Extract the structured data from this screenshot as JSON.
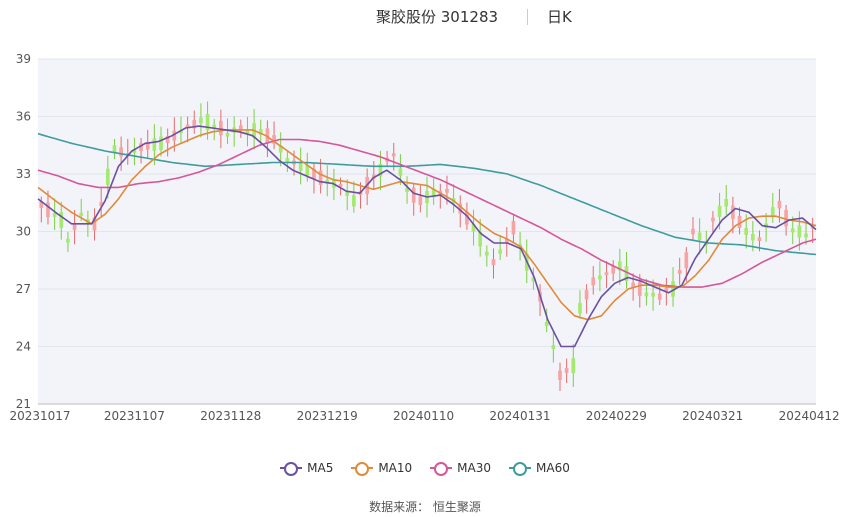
{
  "header": {
    "title": "聚胶股份 301283",
    "period": "日K"
  },
  "source": {
    "label": "数据来源：",
    "value": "恒生聚源"
  },
  "colors": {
    "up": "#f7a3a3",
    "down": "#a3ea6e",
    "ma5": "#6a4fa3",
    "ma10": "#e08a3a",
    "ma30": "#d6569a",
    "ma60": "#3f9c9c",
    "plot_bg": "#f3f4f9"
  },
  "chart_data": {
    "type": "candlestick",
    "ylim": [
      21,
      39
    ],
    "yticks": [
      "39",
      "36",
      "33",
      "30",
      "27",
      "24",
      "21"
    ],
    "ytick_values": [
      39,
      36,
      33,
      30,
      27,
      24,
      21
    ],
    "xtick_labels": [
      "20231017",
      "20231107",
      "20231128",
      "20231219",
      "20240110",
      "20240131",
      "20240229",
      "20240321",
      "20240412"
    ],
    "xtick_positions": [
      0,
      14,
      28,
      42,
      56,
      70,
      84,
      98,
      112
    ],
    "n_bars": 113,
    "legend": [
      "MA5",
      "MA10",
      "MA30",
      "MA60"
    ],
    "candle_keypoints": [
      [
        0,
        31.4
      ],
      [
        3,
        30.6
      ],
      [
        4,
        29.6
      ],
      [
        6,
        30.9
      ],
      [
        8,
        30.4
      ],
      [
        9,
        31.4
      ],
      [
        11,
        34.3
      ],
      [
        13,
        34.0
      ],
      [
        15,
        34.4
      ],
      [
        18,
        34.6
      ],
      [
        21,
        35.2
      ],
      [
        24,
        35.8
      ],
      [
        26,
        35.6
      ],
      [
        28,
        35.2
      ],
      [
        30,
        35.4
      ],
      [
        33,
        35.2
      ],
      [
        35,
        34.8
      ],
      [
        37,
        33.8
      ],
      [
        39,
        33.4
      ],
      [
        41,
        33.0
      ],
      [
        43,
        32.6
      ],
      [
        45,
        32.4
      ],
      [
        47,
        31.6
      ],
      [
        49,
        32.4
      ],
      [
        51,
        33.2
      ],
      [
        53,
        34.0
      ],
      [
        55,
        32.2
      ],
      [
        57,
        31.6
      ],
      [
        59,
        32.0
      ],
      [
        61,
        32.0
      ],
      [
        63,
        31.2
      ],
      [
        65,
        30.2
      ],
      [
        67,
        29.0
      ],
      [
        68,
        28.4
      ],
      [
        70,
        29.5
      ],
      [
        71,
        30.2
      ],
      [
        73,
        28.4
      ],
      [
        75,
        26.6
      ],
      [
        77,
        24.0
      ],
      [
        78,
        22.5
      ],
      [
        80,
        23.0
      ],
      [
        81,
        26.0
      ],
      [
        83,
        27.4
      ],
      [
        85,
        27.8
      ],
      [
        87,
        28.2
      ],
      [
        88,
        27.8
      ],
      [
        89,
        27.2
      ],
      [
        91,
        26.8
      ],
      [
        93,
        26.6
      ],
      [
        95,
        27.0
      ],
      [
        97,
        28.5
      ],
      [
        98,
        30.0
      ],
      [
        100,
        29.5
      ],
      [
        101,
        30.6
      ],
      [
        103,
        31.5
      ],
      [
        104,
        31.0
      ],
      [
        106,
        30.0
      ],
      [
        107,
        29.7
      ],
      [
        108,
        29.6
      ],
      [
        110,
        31.0
      ],
      [
        111,
        31.4
      ],
      [
        112,
        30.7
      ],
      [
        113,
        30.1
      ],
      [
        115,
        29.9
      ],
      [
        116,
        30.2
      ]
    ],
    "candle_count": 117,
    "ma5": [
      [
        0,
        31.7
      ],
      [
        3,
        30.9
      ],
      [
        5,
        30.4
      ],
      [
        8,
        30.4
      ],
      [
        10,
        31.6
      ],
      [
        12,
        33.4
      ],
      [
        14,
        34.2
      ],
      [
        16,
        34.6
      ],
      [
        18,
        34.7
      ],
      [
        20,
        35.0
      ],
      [
        22,
        35.4
      ],
      [
        24,
        35.5
      ],
      [
        26,
        35.4
      ],
      [
        28,
        35.3
      ],
      [
        30,
        35.2
      ],
      [
        32,
        35.0
      ],
      [
        34,
        34.4
      ],
      [
        36,
        33.7
      ],
      [
        38,
        33.2
      ],
      [
        40,
        32.9
      ],
      [
        42,
        32.6
      ],
      [
        44,
        32.5
      ],
      [
        46,
        32.1
      ],
      [
        48,
        32.0
      ],
      [
        50,
        32.8
      ],
      [
        52,
        33.2
      ],
      [
        54,
        32.7
      ],
      [
        56,
        32.0
      ],
      [
        58,
        31.8
      ],
      [
        60,
        31.9
      ],
      [
        62,
        31.4
      ],
      [
        64,
        30.8
      ],
      [
        66,
        29.9
      ],
      [
        68,
        29.4
      ],
      [
        70,
        29.4
      ],
      [
        72,
        29.1
      ],
      [
        74,
        27.6
      ],
      [
        76,
        25.4
      ],
      [
        78,
        24.0
      ],
      [
        80,
        24.0
      ],
      [
        82,
        25.4
      ],
      [
        84,
        26.6
      ],
      [
        86,
        27.3
      ],
      [
        88,
        27.6
      ],
      [
        90,
        27.4
      ],
      [
        92,
        27.1
      ],
      [
        94,
        26.8
      ],
      [
        96,
        27.2
      ],
      [
        98,
        28.6
      ],
      [
        100,
        29.6
      ],
      [
        102,
        30.6
      ],
      [
        104,
        31.2
      ],
      [
        106,
        31.0
      ],
      [
        108,
        30.3
      ],
      [
        110,
        30.2
      ],
      [
        112,
        30.6
      ],
      [
        114,
        30.7
      ],
      [
        116,
        30.1
      ]
    ],
    "ma10": [
      [
        0,
        32.3
      ],
      [
        3,
        31.5
      ],
      [
        5,
        31.0
      ],
      [
        8,
        30.4
      ],
      [
        10,
        30.9
      ],
      [
        12,
        31.7
      ],
      [
        14,
        32.7
      ],
      [
        16,
        33.4
      ],
      [
        18,
        34.0
      ],
      [
        20,
        34.4
      ],
      [
        22,
        34.7
      ],
      [
        24,
        35.0
      ],
      [
        26,
        35.2
      ],
      [
        28,
        35.3
      ],
      [
        30,
        35.3
      ],
      [
        32,
        35.3
      ],
      [
        34,
        35.0
      ],
      [
        36,
        34.5
      ],
      [
        38,
        34.0
      ],
      [
        40,
        33.5
      ],
      [
        42,
        33.0
      ],
      [
        44,
        32.7
      ],
      [
        46,
        32.6
      ],
      [
        48,
        32.4
      ],
      [
        50,
        32.2
      ],
      [
        52,
        32.4
      ],
      [
        54,
        32.6
      ],
      [
        56,
        32.5
      ],
      [
        58,
        32.4
      ],
      [
        60,
        32.0
      ],
      [
        62,
        31.6
      ],
      [
        64,
        31.0
      ],
      [
        66,
        30.4
      ],
      [
        68,
        29.9
      ],
      [
        70,
        29.6
      ],
      [
        72,
        29.2
      ],
      [
        74,
        28.3
      ],
      [
        76,
        27.3
      ],
      [
        78,
        26.3
      ],
      [
        80,
        25.6
      ],
      [
        82,
        25.4
      ],
      [
        84,
        25.6
      ],
      [
        86,
        26.4
      ],
      [
        88,
        27.0
      ],
      [
        90,
        27.2
      ],
      [
        92,
        27.2
      ],
      [
        94,
        27.1
      ],
      [
        96,
        27.1
      ],
      [
        98,
        27.7
      ],
      [
        100,
        28.5
      ],
      [
        102,
        29.6
      ],
      [
        104,
        30.3
      ],
      [
        106,
        30.7
      ],
      [
        108,
        30.8
      ],
      [
        110,
        30.8
      ],
      [
        112,
        30.6
      ],
      [
        114,
        30.5
      ],
      [
        116,
        30.3
      ]
    ],
    "ma30": [
      [
        0,
        33.2
      ],
      [
        3,
        32.9
      ],
      [
        6,
        32.5
      ],
      [
        9,
        32.3
      ],
      [
        12,
        32.3
      ],
      [
        15,
        32.5
      ],
      [
        18,
        32.6
      ],
      [
        21,
        32.8
      ],
      [
        24,
        33.1
      ],
      [
        27,
        33.5
      ],
      [
        30,
        34.0
      ],
      [
        33,
        34.5
      ],
      [
        36,
        34.8
      ],
      [
        39,
        34.8
      ],
      [
        42,
        34.7
      ],
      [
        45,
        34.5
      ],
      [
        48,
        34.2
      ],
      [
        51,
        33.9
      ],
      [
        54,
        33.5
      ],
      [
        57,
        33.1
      ],
      [
        60,
        32.7
      ],
      [
        63,
        32.2
      ],
      [
        66,
        31.7
      ],
      [
        69,
        31.2
      ],
      [
        72,
        30.7
      ],
      [
        75,
        30.2
      ],
      [
        78,
        29.6
      ],
      [
        81,
        29.1
      ],
      [
        84,
        28.5
      ],
      [
        87,
        28.0
      ],
      [
        90,
        27.5
      ],
      [
        93,
        27.2
      ],
      [
        96,
        27.1
      ],
      [
        99,
        27.1
      ],
      [
        102,
        27.3
      ],
      [
        105,
        27.8
      ],
      [
        108,
        28.4
      ],
      [
        111,
        28.9
      ],
      [
        114,
        29.4
      ],
      [
        116,
        29.6
      ]
    ],
    "ma60": [
      [
        0,
        35.1
      ],
      [
        5,
        34.6
      ],
      [
        10,
        34.2
      ],
      [
        15,
        33.9
      ],
      [
        20,
        33.6
      ],
      [
        25,
        33.4
      ],
      [
        30,
        33.5
      ],
      [
        35,
        33.6
      ],
      [
        40,
        33.6
      ],
      [
        45,
        33.5
      ],
      [
        50,
        33.4
      ],
      [
        55,
        33.4
      ],
      [
        60,
        33.5
      ],
      [
        65,
        33.3
      ],
      [
        70,
        33.0
      ],
      [
        75,
        32.4
      ],
      [
        80,
        31.7
      ],
      [
        85,
        31.0
      ],
      [
        90,
        30.3
      ],
      [
        95,
        29.7
      ],
      [
        100,
        29.4
      ],
      [
        105,
        29.3
      ],
      [
        110,
        29.0
      ],
      [
        116,
        28.8
      ]
    ]
  }
}
